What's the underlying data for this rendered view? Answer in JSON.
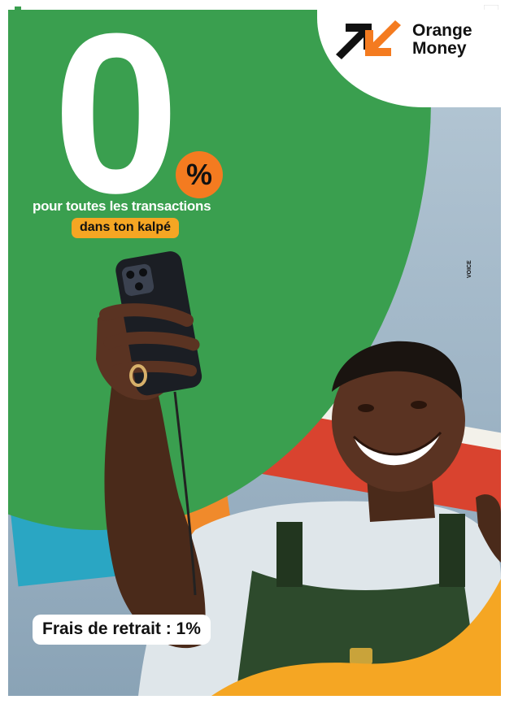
{
  "promo": {
    "headline_number": "0",
    "percent_symbol": "%",
    "tagline": "pour toutes les transactions",
    "highlight": "dans ton kalpé",
    "fee_note": "Frais de retrait : 1%"
  },
  "brand": {
    "line1": "Orange",
    "line2": "Money",
    "logo_icon": "orange-money-arrows-icon"
  },
  "side_label": "VOICE",
  "colors": {
    "green": "#3a9f4f",
    "orange": "#f47b20",
    "yellow": "#f5a623",
    "white": "#ffffff",
    "dark": "#111111"
  }
}
